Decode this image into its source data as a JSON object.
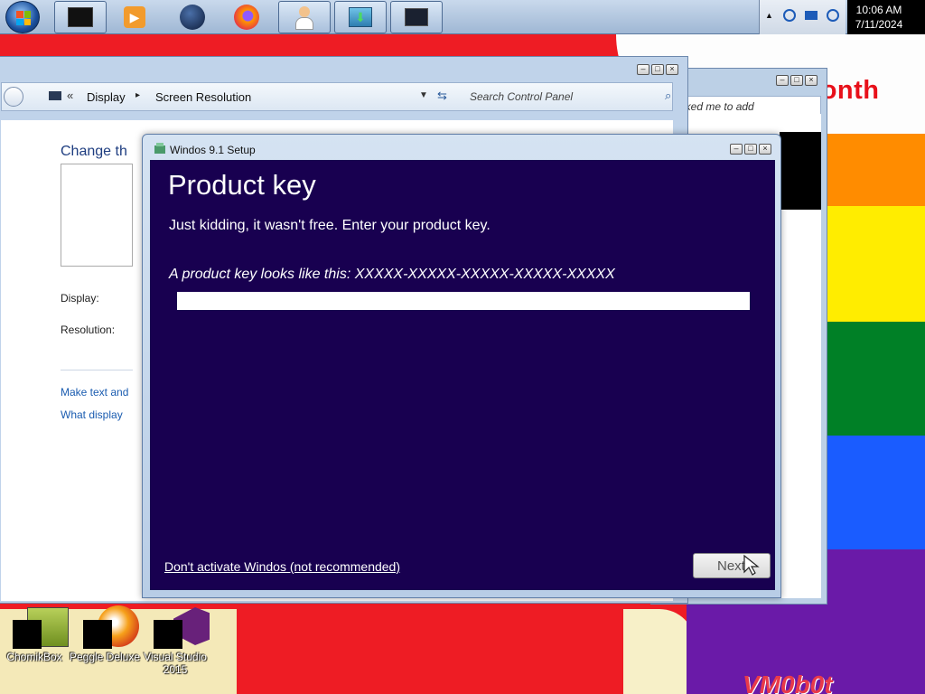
{
  "taskbar": {
    "clock_time": "10:06 AM",
    "clock_date": "7/11/2024",
    "pinned": [
      {
        "name": "black-box-app-icon"
      },
      {
        "name": "media-player-icon"
      },
      {
        "name": "globe-icon"
      },
      {
        "name": "firefox-icon"
      },
      {
        "name": "user-doctor-icon"
      },
      {
        "name": "install-download-icon"
      },
      {
        "name": "monitor-dark-icon"
      }
    ]
  },
  "wallpaper": {
    "banner_text": "happy pride month",
    "signature_text": "VM0b0t",
    "colors": [
      "#ee1c24",
      "#ff8c00",
      "#ffed00",
      "#008026",
      "#1a5cff",
      "#6a1aa8"
    ]
  },
  "desktop_icons": [
    {
      "label": "ChomikBox"
    },
    {
      "label": "Peggle Deluxe"
    },
    {
      "label": "Visual Studio 2015"
    }
  ],
  "control_panel": {
    "breadcrumb_sep": "«",
    "breadcrumb_display": "Display",
    "breadcrumb_bullet": "▸",
    "breadcrumb_current": "Screen Resolution",
    "search_placeholder": "Search Control Panel",
    "heading": "Change th",
    "display_label": "Display:",
    "resolution_label": "Resolution:",
    "link_text": "Make text and",
    "link_display": "What display"
  },
  "second_window": {
    "search_text": "e asked me to add"
  },
  "setup": {
    "window_title": "Windos 9.1 Setup",
    "heading": "Product key",
    "subtitle": "Just kidding, it wasn't free. Enter your product key.",
    "hint": "A product key looks like this: XXXXX-XXXXX-XXXXX-XXXXX-XXXXX",
    "key_value": "",
    "skip_link": "Don't activate Windos (not recommended)",
    "next_button": "Next"
  }
}
